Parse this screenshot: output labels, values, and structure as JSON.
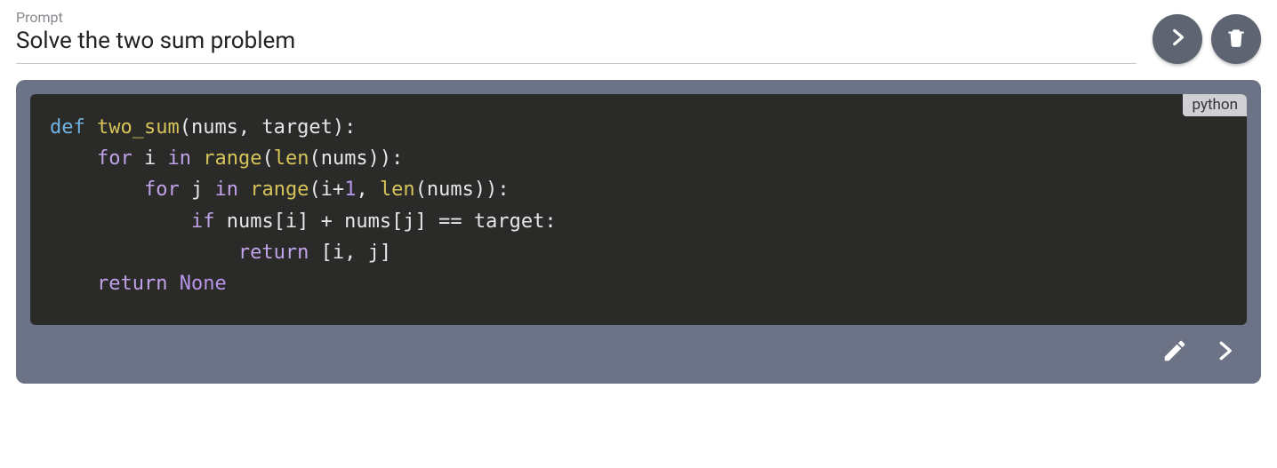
{
  "prompt": {
    "label": "Prompt",
    "text": "Solve the two sum problem"
  },
  "response": {
    "language_badge": "python",
    "code_tokens": [
      [
        {
          "t": "def ",
          "c": "kw"
        },
        {
          "t": "two_sum",
          "c": "fn"
        },
        {
          "t": "(nums, target):",
          "c": "p"
        }
      ],
      [
        {
          "t": "    ",
          "c": "p"
        },
        {
          "t": "for ",
          "c": "ctrl"
        },
        {
          "t": "i ",
          "c": "id"
        },
        {
          "t": "in ",
          "c": "ctrl"
        },
        {
          "t": "range",
          "c": "bi"
        },
        {
          "t": "(",
          "c": "p"
        },
        {
          "t": "len",
          "c": "bi"
        },
        {
          "t": "(nums)):",
          "c": "p"
        }
      ],
      [
        {
          "t": "        ",
          "c": "p"
        },
        {
          "t": "for ",
          "c": "ctrl"
        },
        {
          "t": "j ",
          "c": "id"
        },
        {
          "t": "in ",
          "c": "ctrl"
        },
        {
          "t": "range",
          "c": "bi"
        },
        {
          "t": "(i+",
          "c": "p"
        },
        {
          "t": "1",
          "c": "num"
        },
        {
          "t": ", ",
          "c": "p"
        },
        {
          "t": "len",
          "c": "bi"
        },
        {
          "t": "(nums)):",
          "c": "p"
        }
      ],
      [
        {
          "t": "            ",
          "c": "p"
        },
        {
          "t": "if ",
          "c": "ctrl"
        },
        {
          "t": "nums[i] + nums[j] == target:",
          "c": "p"
        }
      ],
      [
        {
          "t": "                ",
          "c": "p"
        },
        {
          "t": "return ",
          "c": "ctrl"
        },
        {
          "t": "[i, j]",
          "c": "p"
        }
      ],
      [
        {
          "t": "    ",
          "c": "p"
        },
        {
          "t": "return ",
          "c": "ctrl"
        },
        {
          "t": "None",
          "c": "const"
        }
      ]
    ]
  },
  "colors": {
    "card_bg": "#6d7386",
    "code_bg": "#2a2a28",
    "btn_bg": "#5e6472"
  }
}
